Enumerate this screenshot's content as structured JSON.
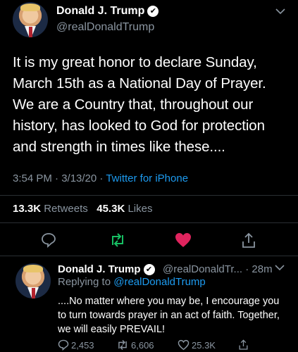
{
  "header": {
    "display_name": "Donald J. Trump",
    "handle": "@realDonaldTrump",
    "chevron": "⌄"
  },
  "tweet": {
    "text": "It is my great honor to declare Sunday, March 15th as a National Day of Prayer. We are a Country that, throughout our history, has looked to God for protection and strength in times like these....",
    "time": "3:54 PM · 3/13/20 · ",
    "source": "Twitter for iPhone",
    "retweets_count": "13.3K",
    "retweets_label": "Retweets",
    "likes_count": "45.3K",
    "likes_label": "Likes"
  },
  "actions": {
    "icons": [
      "reply-icon",
      "retweet-icon",
      "like-icon",
      "share-icon"
    ],
    "like_color": "#e0245e",
    "retweet_color": "#17bf63"
  },
  "reply": {
    "display_name": "Donald J. Trump",
    "handle_time": "@realDonaldTr... · 28m",
    "replying_prefix": "Replying to ",
    "replying_handle": "@realDonaldTrump",
    "text": "....No matter where you may be, I encourage you to turn towards prayer in an act of faith. Together, we will easily PREVAIL!",
    "reply_count": "2,453",
    "retweet_count": "6,606",
    "like_count": "25.3K"
  },
  "colors": {
    "background": "#000000",
    "link": "#1d9bf0",
    "muted": "#8a95a0"
  }
}
